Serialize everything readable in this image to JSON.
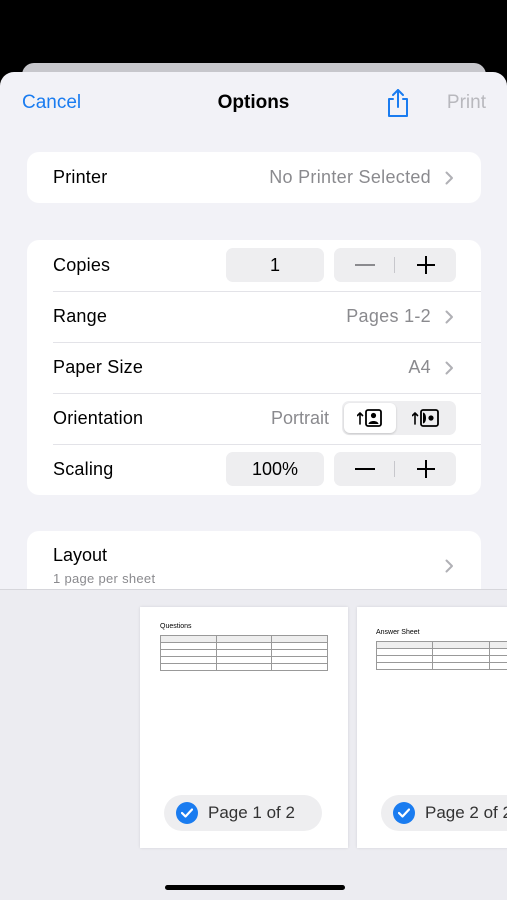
{
  "nav": {
    "cancel_label": "Cancel",
    "title": "Options",
    "share_icon": "share-icon",
    "print_label": "Print"
  },
  "printer": {
    "label": "Printer",
    "value": "No Printer Selected"
  },
  "copies": {
    "label": "Copies",
    "value": "1",
    "minus": "—",
    "plus": "+"
  },
  "range": {
    "label": "Range",
    "value": "Pages 1-2"
  },
  "paper_size": {
    "label": "Paper Size",
    "value": "A4"
  },
  "orientation": {
    "label": "Orientation",
    "value": "Portrait",
    "options": [
      "portrait-icon",
      "landscape-icon"
    ],
    "selected": "Portrait"
  },
  "scaling": {
    "label": "Scaling",
    "value": "100%",
    "minus": "—",
    "plus": "+"
  },
  "layout": {
    "label": "Layout",
    "sublabel": "1 page per sheet"
  },
  "preview": {
    "pages": [
      {
        "doc_title": "Questions",
        "label": "Page 1 of 2",
        "selected": true
      },
      {
        "doc_title": "Answer Sheet",
        "label": "Page 2 of 2",
        "selected": true
      }
    ]
  },
  "colors": {
    "accent": "#1a7cf0",
    "background": "#f2f2f7",
    "disabled": "#b8b8bd"
  }
}
